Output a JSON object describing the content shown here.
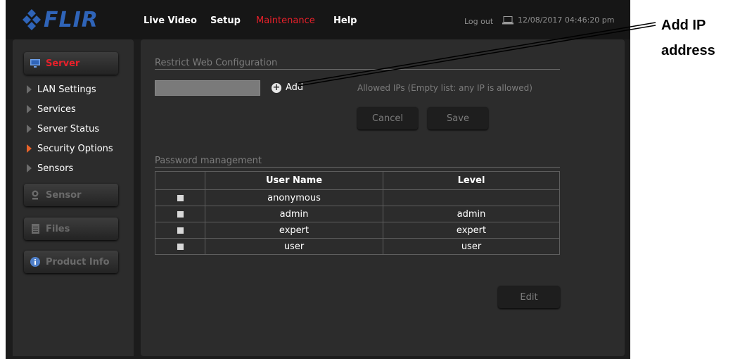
{
  "brand": {
    "logo_text": "FLIR",
    "logo_color": "#2f64b8"
  },
  "header": {
    "nav": [
      "Live Video",
      "Setup",
      "Maintenance",
      "Help"
    ],
    "active_nav": "Maintenance",
    "logout": "Log out",
    "datetime": "12/08/2017 04:46:20 pm"
  },
  "sidebar": {
    "modules": [
      {
        "label": "Server",
        "icon": "monitor-icon",
        "active": true
      },
      {
        "label": "Sensor",
        "icon": "camera-icon",
        "active": false
      },
      {
        "label": "Files",
        "icon": "document-icon",
        "active": false
      },
      {
        "label": "Product Info",
        "icon": "info-icon",
        "active": false
      }
    ],
    "server_items": [
      {
        "label": "LAN Settings",
        "active": false
      },
      {
        "label": "Services",
        "active": false
      },
      {
        "label": "Server Status",
        "active": false
      },
      {
        "label": "Security Options",
        "active": true
      },
      {
        "label": "Sensors",
        "active": false
      }
    ]
  },
  "restrict": {
    "title": "Restrict Web Configuration",
    "ip_value": "",
    "add_label": "Add",
    "allowed_label": "Allowed IPs  (Empty list: any IP is allowed)",
    "cancel": "Cancel",
    "save": "Save"
  },
  "password": {
    "title": "Password management",
    "headers": [
      "User Name",
      "Level"
    ],
    "rows": [
      {
        "name": "anonymous",
        "level": ""
      },
      {
        "name": "admin",
        "level": "admin"
      },
      {
        "name": "expert",
        "level": "expert"
      },
      {
        "name": "user",
        "level": "user"
      }
    ],
    "edit": "Edit"
  },
  "annotation": {
    "line1": "Add IP",
    "line2": "address"
  },
  "colors": {
    "accent_red": "#e8202a",
    "active_arrow": "#e8632a",
    "panel": "#2c2c2c",
    "background": "#1c1c1c"
  }
}
